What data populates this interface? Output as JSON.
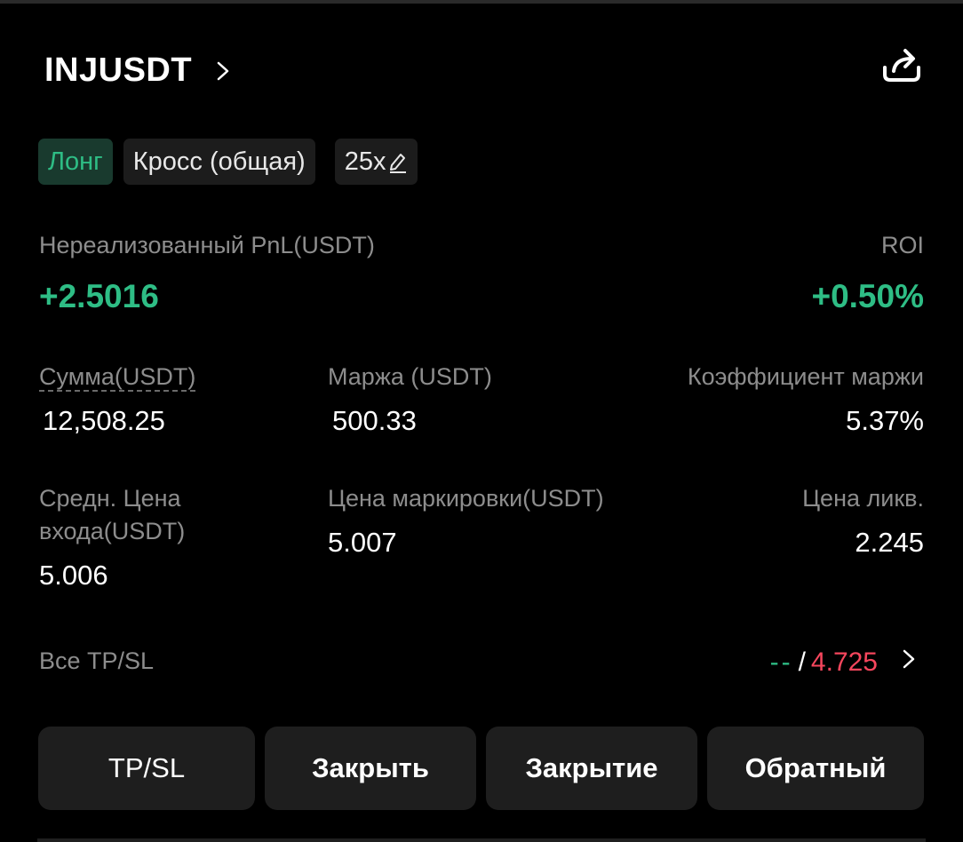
{
  "header": {
    "symbol": "INJUSDT"
  },
  "tags": {
    "side": "Лонг",
    "margin_mode": "Кросс (общая)",
    "leverage": "25x"
  },
  "pnl": {
    "label": "Нереализованный PnL(USDT)",
    "value": "+2.5016",
    "roi_label": "ROI",
    "roi_value": "+0.50%"
  },
  "stats": {
    "size_label": "Сумма(USDT)",
    "size_value": "12,508.25",
    "margin_label": "Маржа (USDT)",
    "margin_value": "500.33",
    "margin_ratio_label": "Коэффициент маржи",
    "margin_ratio_value": "5.37%",
    "entry_label_line1": "Средн. Цена",
    "entry_label_line2": "входа(USDT)",
    "entry_value": "5.006",
    "mark_label": "Цена маркировки(USDT)",
    "mark_value": "5.007",
    "liq_label": "Цена ликв.",
    "liq_value": "2.245"
  },
  "tpsl": {
    "label": "Все TP/SL",
    "tp_value": "--",
    "separator": "/",
    "sl_value": "4.725"
  },
  "actions": {
    "tpsl": "TP/SL",
    "close": "Закрыть",
    "close_all": "Закрытие",
    "reverse": "Обратный"
  },
  "colors": {
    "profit_green": "#2ebd85",
    "loss_red": "#f6465d",
    "background": "#000000",
    "button_bg": "#1e1e1e"
  },
  "icons": [
    "chevron-right-icon",
    "share-icon",
    "edit-pencil-icon"
  ]
}
